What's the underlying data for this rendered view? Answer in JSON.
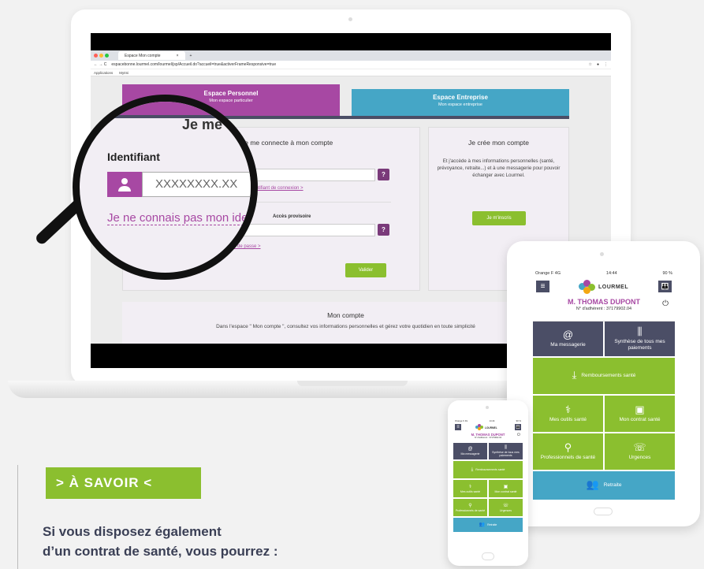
{
  "browser": {
    "tab_title": "Espace Mon compte",
    "tab_close": "×",
    "tab_new": "+",
    "nav": "← → C",
    "url": "espacebonne.lourmel.com/lourmel/jsp/Accueil.do?accueil=true&activerFrameResponsive=true",
    "bookmarks": [
      "Applications",
      "Mytmi"
    ]
  },
  "site": {
    "tab_perso": "Espace Personnel",
    "tab_perso_sub": "Mon espace particulier",
    "tab_ent": "Espace Entreprise",
    "tab_ent_sub": "Mon espace entreprise",
    "login_title": "Je me connecte à mon compte",
    "forgot_id": "Identifiant de connexion >",
    "access_label": "Accès provisoire",
    "forgot_pw": "Mon mot de passe >",
    "validate": "Valider",
    "signup_title": "Je crée mon compte",
    "signup_text": "Et j'accède à mes informations personnelles (santé, prévoyance, retraite...) et à une messagerie pour pouvoir échanger avec Lourmel.",
    "signup_button": "Je m'inscris",
    "account_title": "Mon compte",
    "account_text": "Dans l'espace \" Mon compte \", consultez vos informations personnelles et gérez votre quotidien en toute simplicité"
  },
  "magnifier": {
    "title": "Je me",
    "id_label": "Identifiant",
    "id_placeholder": "XXXXXXXX.XX",
    "link": "Je ne connais pas mon identifiant"
  },
  "app": {
    "carrier": "Orange F  4G",
    "time": "14:44",
    "battery": "90 %",
    "logo": "LOURMEL",
    "name": "M. THOMAS DUPONT",
    "member": "N° d'adhérent : 37179902.04",
    "tiles": {
      "messagerie": "Ma messagerie",
      "synthese": "Synthèse de tous mes paiements",
      "remboursements": "Remboursements santé",
      "outils": "Mes outils santé",
      "contrat": "Mon contrat santé",
      "pros": "Professionnels de santé",
      "urgences": "Urgences",
      "retraite": "Retraite"
    }
  },
  "savoir": {
    "badge": "> À SAVOIR <",
    "line1": "Si vous disposez également",
    "line2": "d’un contrat de santé, vous pourrez :"
  },
  "colors": {
    "purple": "#a748a3",
    "teal": "#45a6c6",
    "green": "#8bbf2f",
    "slate": "#4b4e66"
  }
}
